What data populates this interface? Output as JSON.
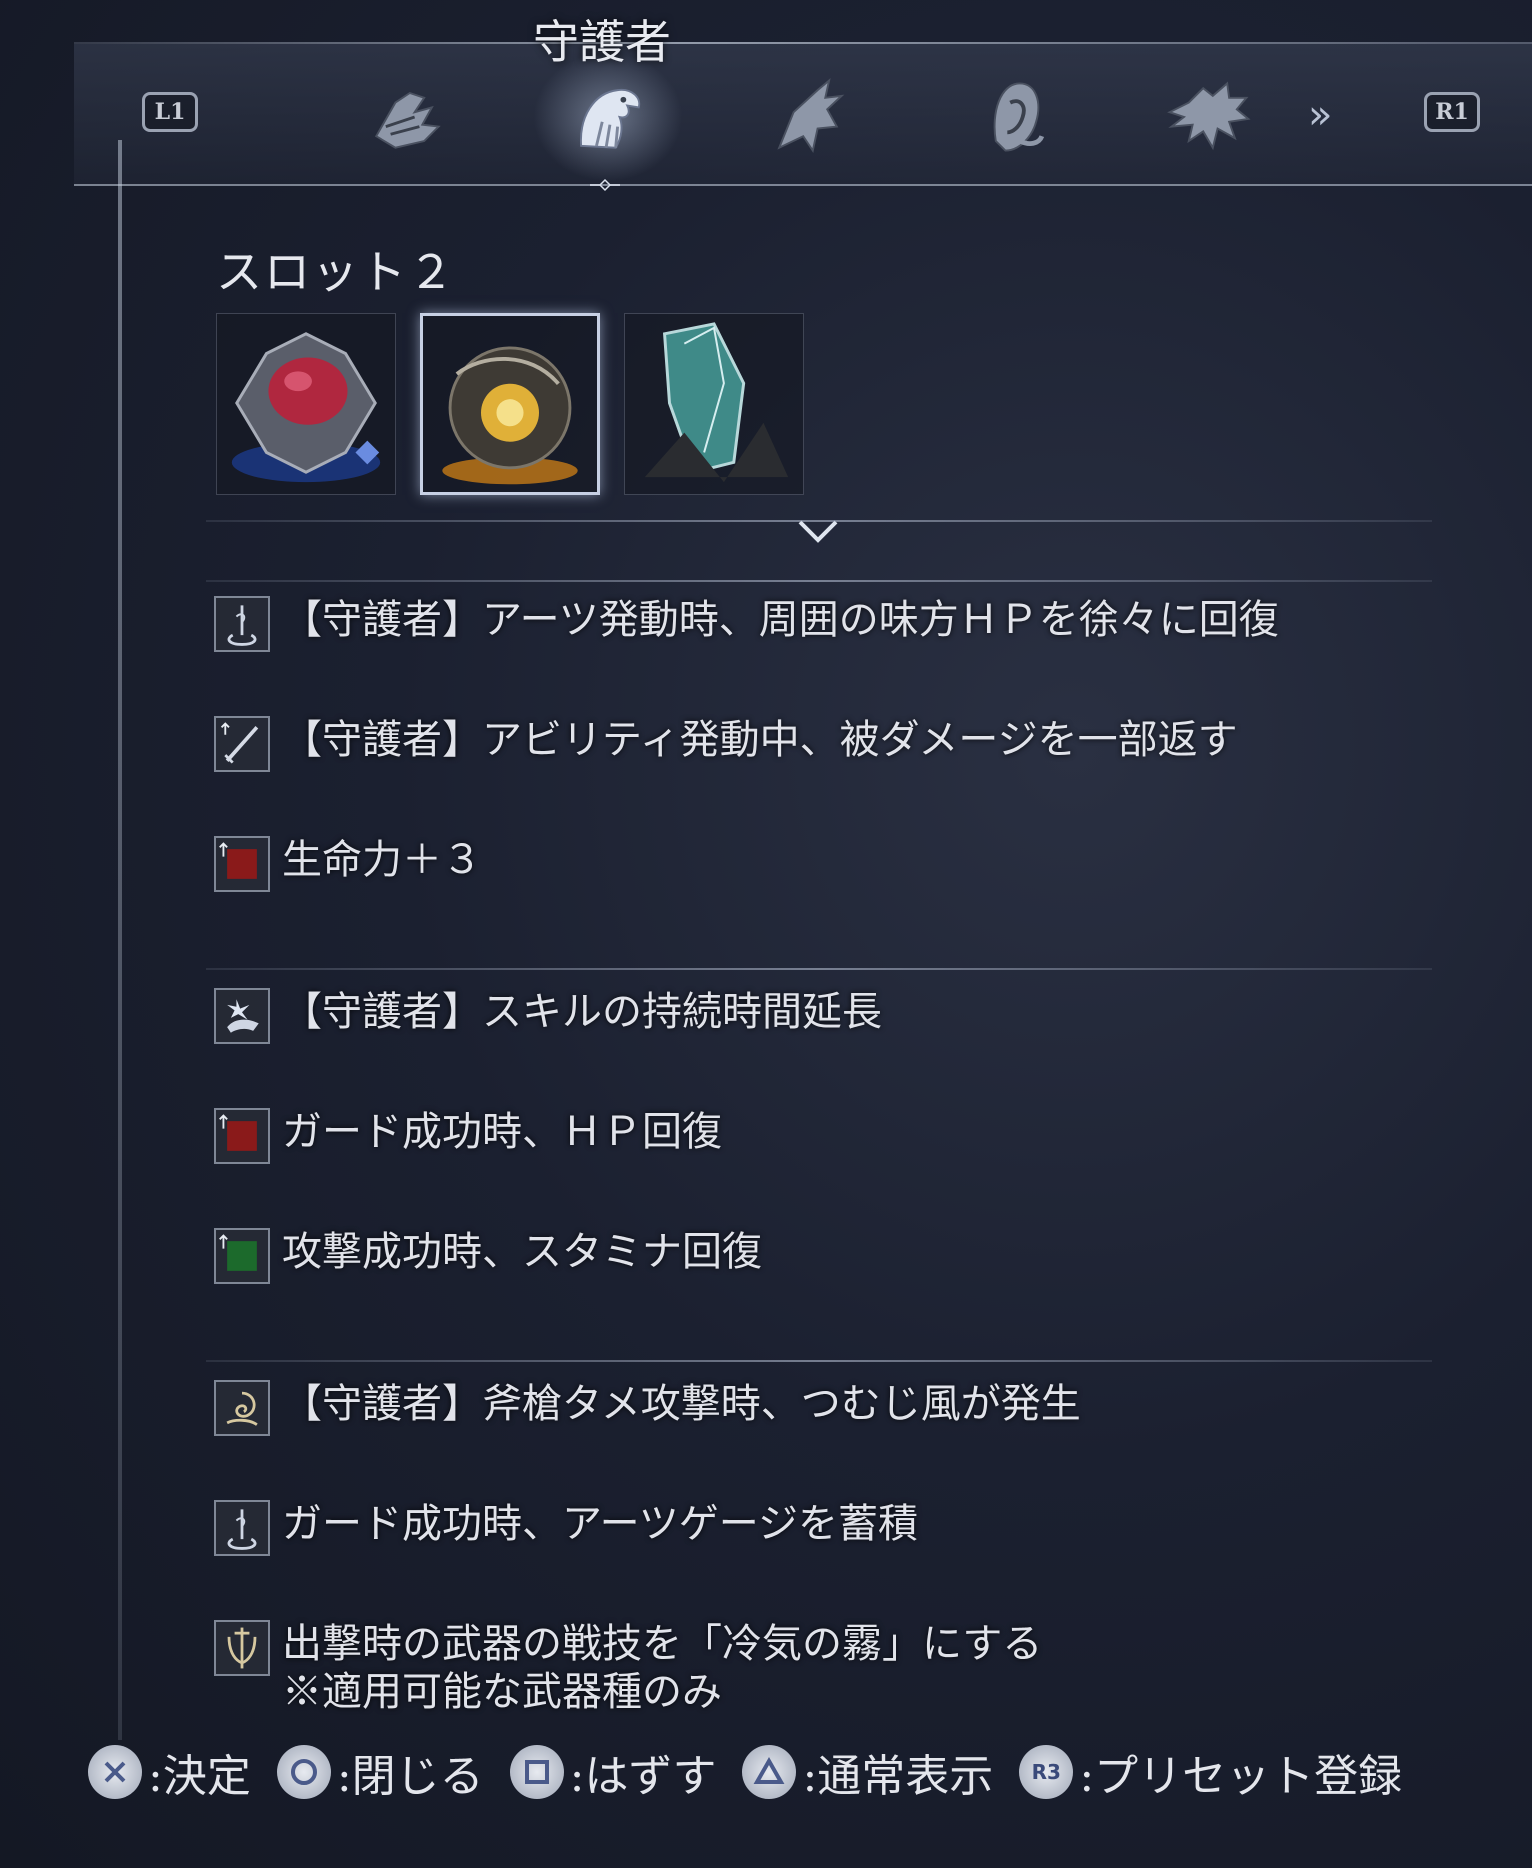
{
  "header": {
    "class_title": "守護者",
    "left_shoulder": "L1",
    "right_shoulder": "R1",
    "tabs": [
      {
        "name": "tab-class-1",
        "icon": "winged-helm-emblem-icon",
        "active": false
      },
      {
        "name": "tab-guardian",
        "icon": "eagle-head-emblem-icon",
        "active": true
      },
      {
        "name": "tab-class-3",
        "icon": "crow-emblem-icon",
        "active": false
      },
      {
        "name": "tab-class-4",
        "icon": "hooded-face-emblem-icon",
        "active": false
      },
      {
        "name": "tab-class-5",
        "icon": "dragon-emblem-icon",
        "active": false
      }
    ],
    "more_icon": "double-chevron-right-icon"
  },
  "slot": {
    "title": "スロット２",
    "relics": [
      {
        "icon": "red-gem-relic-icon",
        "selected": false
      },
      {
        "icon": "golden-orb-relic-icon",
        "selected": true
      },
      {
        "icon": "teal-crystal-relic-icon",
        "selected": false
      }
    ]
  },
  "effect_groups": [
    {
      "effects": [
        {
          "icon": "arts-swirl-icon",
          "color": "#8b93a3",
          "text": "【守護者】アーツ発動時、周囲の味方ＨＰを徐々に回復"
        },
        {
          "icon": "sword-icon",
          "color": "#8b93a3",
          "text": "【守護者】アビリティ発動中、被ダメージを一部返す"
        },
        {
          "icon": "red-square-stat-icon",
          "color": "#8a1a1a",
          "text": "生命力＋３"
        }
      ]
    },
    {
      "effects": [
        {
          "icon": "skill-hand-icon",
          "color": "#8b93a3",
          "text": "【守護者】スキルの持続時間延長"
        },
        {
          "icon": "red-square-stat-icon",
          "color": "#8a1a1a",
          "text": "ガード成功時、ＨＰ回復"
        },
        {
          "icon": "green-square-stat-icon",
          "color": "#1c6a2c",
          "text": "攻撃成功時、スタミナ回復"
        }
      ]
    },
    {
      "effects": [
        {
          "icon": "spiral-wind-icon",
          "color": "#8b93a3",
          "text": "【守護者】斧槍タメ攻撃時、つむじ風が発生"
        },
        {
          "icon": "arts-swirl-icon",
          "color": "#8b93a3",
          "text": "ガード成功時、アーツゲージを蓄積"
        },
        {
          "icon": "weapon-skill-icon",
          "color": "#8b93a3",
          "text": "出撃時の武器の戦技を「冷気の霧」にする",
          "sub": "※適用可能な武器種のみ"
        }
      ]
    }
  ],
  "footer": {
    "buttons": [
      {
        "icon": "cross-button-icon",
        "label": ":決定"
      },
      {
        "icon": "circle-button-icon",
        "label": ":閉じる"
      },
      {
        "icon": "square-button-icon",
        "label": ":はずす"
      },
      {
        "icon": "triangle-button-icon",
        "label": ":通常表示"
      },
      {
        "icon": "r3-button-icon",
        "label": ":プリセット登録",
        "badge": "R3"
      }
    ]
  }
}
